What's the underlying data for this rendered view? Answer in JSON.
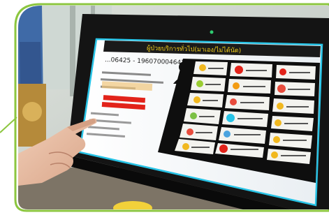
{
  "photo": {
    "subject": "Hand touching a kiosk touchscreen showing a Thai service selection interface",
    "colors": {
      "frame_green": "#8cc63f",
      "kiosk_bezel": "#141414",
      "screen_header": "#1a1a1a",
      "header_text": "#f7d21a",
      "panel_bg": "#0e0e0e",
      "tile_bg": "#f3f3ef",
      "red_bar": "#e2231a",
      "cyan_glow": "#27c3e6"
    }
  },
  "screen": {
    "header_title": "ผู้ป่วยบริการทั่วไป(มาเอง/ไม่ได้นัด)",
    "id_line": "...06425 - 196070004647",
    "icon_names": [
      "user-silhouette-icon",
      "ambulance-icon",
      "medicine-icon",
      "vaccine-icon",
      "stethoscope-icon",
      "heart-icon",
      "baby-icon",
      "tooth-icon",
      "eye-icon",
      "lungs-icon",
      "x-mark-icon"
    ]
  }
}
